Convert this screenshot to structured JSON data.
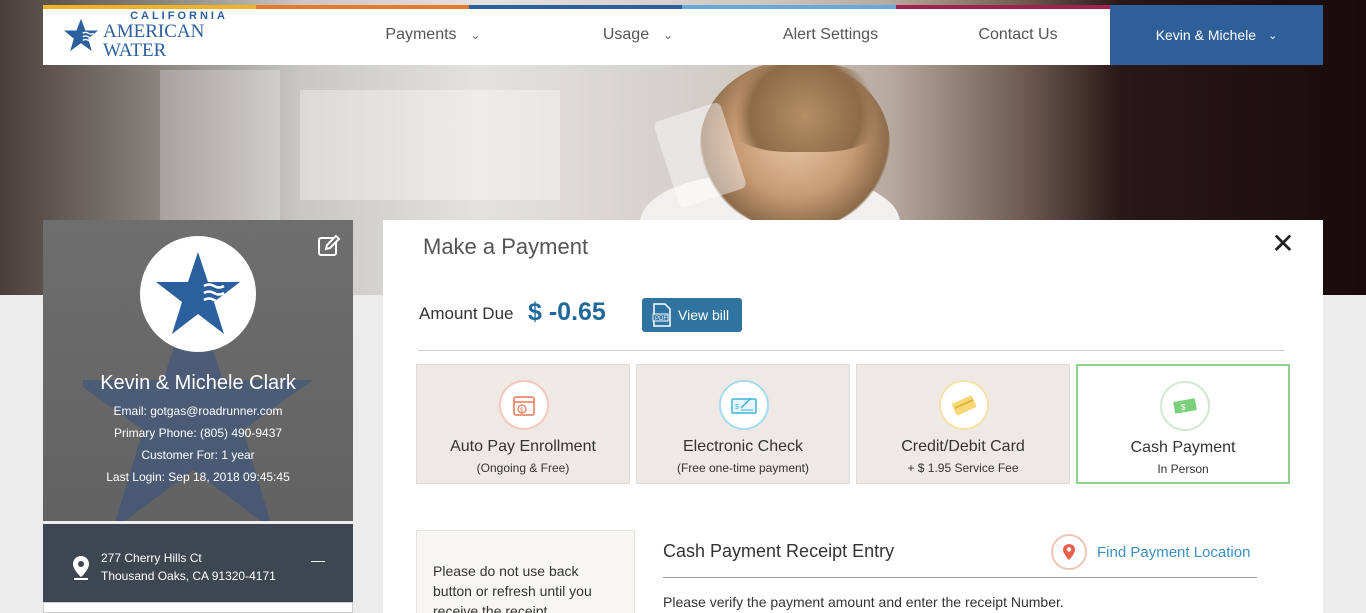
{
  "brand": {
    "line1": "CALIFORNIA",
    "line2": "AMERICAN WATER"
  },
  "nav": {
    "items": [
      {
        "label": "Payments",
        "has_dropdown": true
      },
      {
        "label": "Usage",
        "has_dropdown": true
      },
      {
        "label": "Alert Settings",
        "has_dropdown": false
      },
      {
        "label": "Contact Us",
        "has_dropdown": false
      }
    ],
    "user_menu": {
      "label": "Kevin & Michele",
      "has_dropdown": true
    },
    "accent_colors": [
      "#f0b323",
      "#e8782a",
      "#2b5f9e",
      "#6aa8d8",
      "#a1224f",
      "#7cb342"
    ],
    "user_bg": "#2f5f98"
  },
  "profile": {
    "name": "Kevin & Michele Clark",
    "email": "Email: gotgas@roadrunner.com",
    "phone": "Primary Phone: (805) 490-9437",
    "customer_for": "Customer For: 1 year",
    "last_login": "Last Login: Sep 18, 2018 09:45:45",
    "edit_icon": "edit-icon"
  },
  "address": {
    "line1": "277 Cherry Hills Ct",
    "line2": "Thousand Oaks, CA 91320-4171",
    "toggle": "—"
  },
  "payment": {
    "title": "Make a Payment",
    "close": "✕",
    "amount_label": "Amount Due",
    "amount_value": "$ -0.65",
    "view_bill": "View bill",
    "options": [
      {
        "title": "Auto Pay Enrollment",
        "subtitle": "(Ongoing & Free)",
        "icon": "calendar-dollar-icon",
        "selected": false
      },
      {
        "title": "Electronic Check",
        "subtitle": "(Free one-time payment)",
        "icon": "check-icon",
        "selected": false
      },
      {
        "title": "Credit/Debit Card",
        "subtitle": "+ $ 1.95 Service Fee",
        "icon": "credit-card-icon",
        "selected": false
      },
      {
        "title": "Cash Payment",
        "subtitle": "In Person",
        "icon": "cash-icon",
        "selected": true
      }
    ],
    "warning": "Please do not use back button or refresh until you receive the receipt confirmation page.",
    "receipt_title": "Cash Payment Receipt Entry",
    "find_location": "Find Payment Location",
    "verify_text": "Please verify the payment amount and enter the receipt Number."
  }
}
